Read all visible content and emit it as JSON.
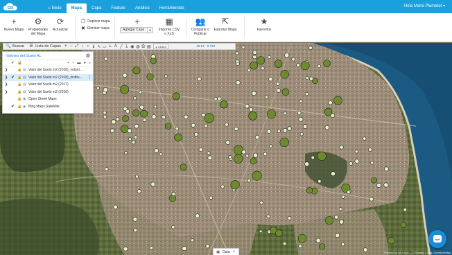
{
  "nav": {
    "tabs": [
      {
        "label": "Inicio",
        "icon": "home-icon"
      },
      {
        "label": "Mapa",
        "active": true
      },
      {
        "label": "Capa"
      },
      {
        "label": "Feature"
      },
      {
        "label": "Análisis"
      },
      {
        "label": "Herramientas"
      }
    ],
    "user": "Hola Mario Plumetot ▾"
  },
  "ribbon": {
    "nuevo_mapa": "Nuevo Mapa",
    "propiedades": "Propiedades del Mapa",
    "actualizar": "Actualizar",
    "duplicar": "Duplicar mapa",
    "eliminar": "Eliminar mapa",
    "agregar_capa": "Agregar Capa",
    "importar": "Importar CSV o XLS",
    "compartir": "Compartir o Publicar",
    "exportar": "Exportar Mapa",
    "favoritos": "Favoritos"
  },
  "map_toolbar": {
    "buscar": "Buscar",
    "lista_capas": "Lista de Capas",
    "scale": "1:72224",
    "coords": "-38.97, -0.729"
  },
  "layers": {
    "title": "Valores del Suelo AL",
    "items": [
      {
        "name": "Valor del Suelo m2 (2018)_volunt...",
        "checked": false,
        "selected": false
      },
      {
        "name": "Valor del Suelo m2 (2018)_institu...",
        "checked": true,
        "selected": true
      },
      {
        "name": "Valor del Suelo m2 (2017)",
        "checked": false,
        "selected": false
      },
      {
        "name": "Valor del Suelo m2 (2016)",
        "checked": false,
        "selected": false
      },
      {
        "name": "Open Street Maps",
        "checked": false,
        "selected": false
      },
      {
        "name": "Bing Maps SateMite",
        "checked": true,
        "selected": false
      }
    ]
  },
  "bottom": {
    "data_label": "Data"
  },
  "attribution": "Powered by Urb Cloud — © Plumetio & Bing, OpenStreetMap",
  "colors": {
    "brand": "#1aa0dd",
    "marker_small": "#e8f2c8",
    "marker_large": "#6e8a2e",
    "chat": "#1a8cd8"
  }
}
